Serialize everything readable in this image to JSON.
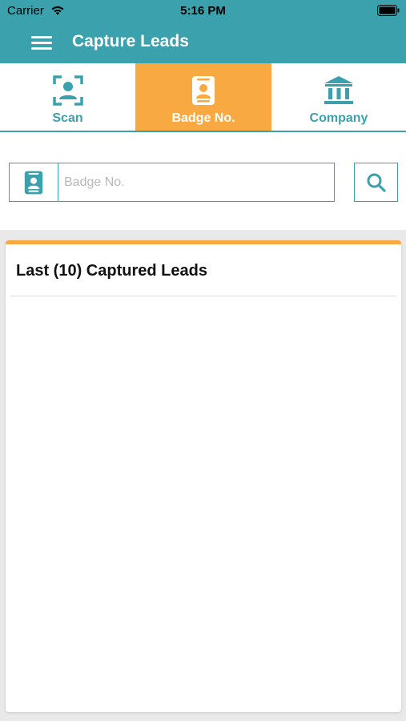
{
  "status_bar": {
    "carrier": "Carrier",
    "time": "5:16 PM"
  },
  "header": {
    "title": "Capture Leads",
    "menu_icon": "hamburger-menu-icon"
  },
  "tabs": [
    {
      "label": "Scan",
      "icon": "face-scan-icon",
      "active": false
    },
    {
      "label": "Badge No.",
      "icon": "badge-icon",
      "active": true
    },
    {
      "label": "Company",
      "icon": "bank-building-icon",
      "active": false
    }
  ],
  "search": {
    "placeholder": "Badge No.",
    "value": "",
    "field_icon": "badge-icon",
    "button_icon": "search-icon"
  },
  "leads": {
    "title": "Last (10) Captured Leads",
    "items": []
  },
  "colors": {
    "primary": "#3aa1ad",
    "accent": "#f9a942",
    "background": "#e9e9e9"
  }
}
